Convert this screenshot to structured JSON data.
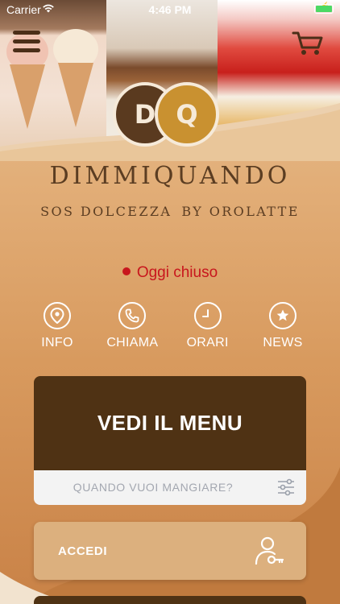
{
  "status_bar": {
    "carrier": "Carrier",
    "time": "4:46 PM",
    "battery_color": "#4cd964"
  },
  "header": {
    "menu_icon": "hamburger-icon",
    "cart_icon": "cart-icon"
  },
  "logo": {
    "left_letter": "D",
    "right_letter": "Q",
    "left_color": "#5a3a1f",
    "right_color": "#c99130"
  },
  "brand": {
    "title": "DIMMIQUANDO",
    "subtitle_left": "SOS DOLCEZZA",
    "subtitle_right": "BY OROLATTE"
  },
  "store_status": {
    "text": "Oggi chiuso",
    "color": "#c8161d"
  },
  "actions": [
    {
      "label": "INFO",
      "icon": "location-pin-icon"
    },
    {
      "label": "CHIAMA",
      "icon": "phone-icon"
    },
    {
      "label": "ORARI",
      "icon": "clock-icon"
    },
    {
      "label": "NEWS",
      "icon": "star-bubble-icon"
    }
  ],
  "menu_card": {
    "title": "VEDI IL MENU",
    "when_placeholder": "QUANDO VUOI MANGIARE?",
    "filter_icon": "sliders-icon"
  },
  "login": {
    "label": "ACCEDI",
    "icon": "user-key-icon"
  },
  "colors": {
    "brand_brown": "#4f3214",
    "accent_gold": "#c99130",
    "button_tan": "#dcb07e"
  }
}
